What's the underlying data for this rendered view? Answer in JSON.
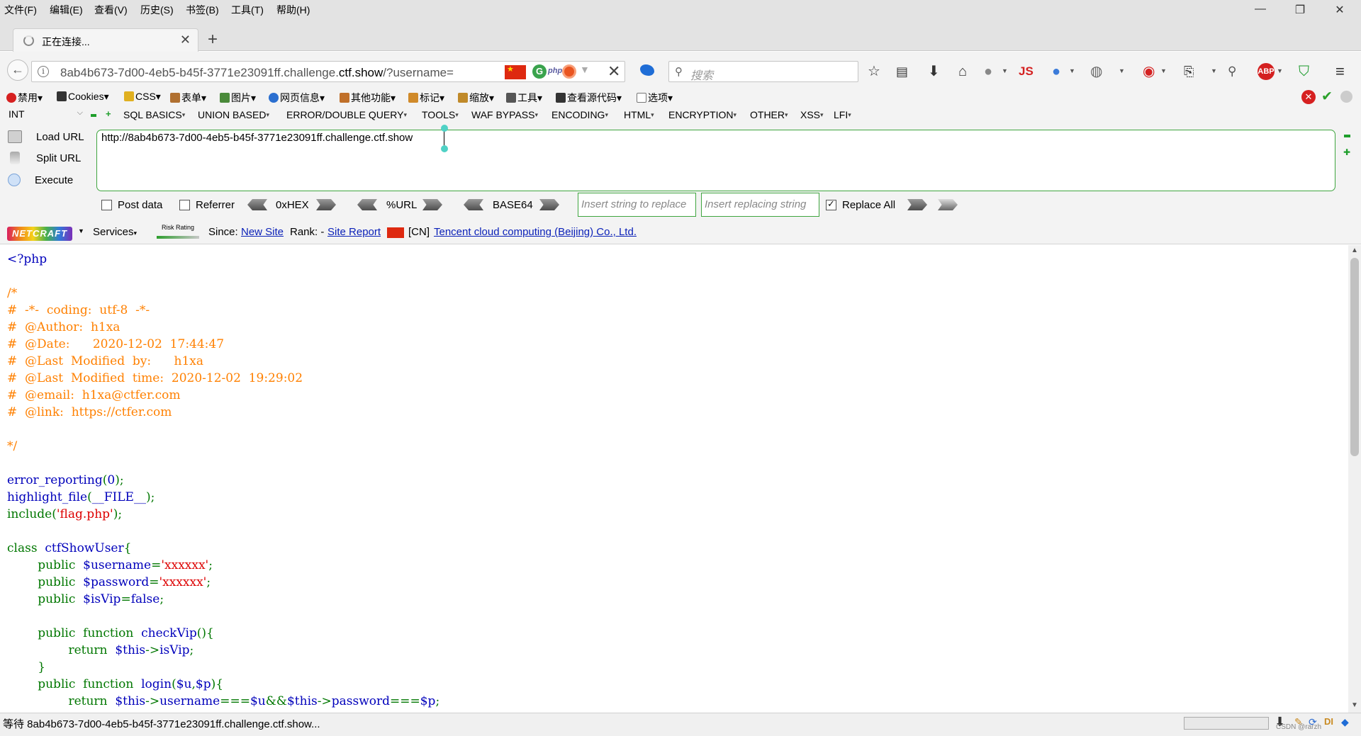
{
  "menu": [
    "文件(F)",
    "编辑(E)",
    "查看(V)",
    "历史(S)",
    "书签(B)",
    "工具(T)",
    "帮助(H)"
  ],
  "window": {
    "minimize": "—",
    "restore": "❐",
    "close": "✕"
  },
  "tab": {
    "title": "正在连接...",
    "close": "✕",
    "new_tab": "+"
  },
  "nav": {
    "back": "←",
    "url_prefix": "8ab4b673-7d00-4eb5-b45f-3771e23091ff.challenge.",
    "url_host": "ctf.show",
    "url_suffix": "/?username=",
    "php_label": "php",
    "stop": "✕",
    "search_placeholder": "搜索",
    "js_label": "JS",
    "abp_label": "ABP"
  },
  "cnbar": [
    {
      "label": "禁用",
      "color": "#d62020"
    },
    {
      "label": "Cookies",
      "color": "#333333"
    },
    {
      "label": "CSS",
      "color": "#e0b020"
    },
    {
      "label": "表单",
      "color": "#b07030"
    },
    {
      "label": "图片",
      "color": "#4a8a3a"
    },
    {
      "label": "网页信息",
      "color": "#2b6fd0"
    },
    {
      "label": "其他功能",
      "color": "#c0702a"
    },
    {
      "label": "标记",
      "color": "#d08a2a"
    },
    {
      "label": "缩放",
      "color": "#c08a2a"
    },
    {
      "label": "工具",
      "color": "#555555"
    },
    {
      "label": "查看源代码",
      "color": "#333333"
    },
    {
      "label": "选项",
      "color": "#777777"
    }
  ],
  "hackbar": {
    "select": "INT",
    "menus": [
      "SQL BASICS",
      "UNION BASED",
      "ERROR/DOUBLE QUERY",
      "TOOLS",
      "WAF BYPASS",
      "ENCODING",
      "HTML",
      "ENCRYPTION",
      "OTHER",
      "XSS",
      "LFI"
    ],
    "load_url": "Load URL",
    "split_url": "Split URL",
    "execute": "Execute",
    "url_value": "http://8ab4b673-7d00-4eb5-b45f-3771e23091ff.challenge.ctf.show",
    "post_data": "Post data",
    "referrer": "Referrer",
    "hex": "0xHEX",
    "urlenc": "%URL",
    "base64": "BASE64",
    "insert_placeholder": "Insert string to replace",
    "replacing_placeholder": "Insert replacing string",
    "replace_all": "Replace All",
    "post_checked": false,
    "referrer_checked": false,
    "replace_all_checked": true
  },
  "netcraft": {
    "logo": "NETCRAFT",
    "services": "Services",
    "risk": "Risk Rating",
    "since_label": "Since:",
    "since_link": "New Site",
    "rank_label": "Rank: -",
    "site_report": "Site Report",
    "country": "[CN]",
    "host_link": "Tencent cloud computing (Beijing) Co., Ltd."
  },
  "source_lines": [
    [
      {
        "c": "tag",
        "t": "<?php"
      }
    ],
    [],
    [
      {
        "c": "com",
        "t": "/*"
      }
    ],
    [
      {
        "c": "com",
        "t": "#  -*-  coding:  utf-8  -*-"
      }
    ],
    [
      {
        "c": "com",
        "t": "#  @Author:  h1xa"
      }
    ],
    [
      {
        "c": "com",
        "t": "#  @Date:      2020-12-02  17:44:47"
      }
    ],
    [
      {
        "c": "com",
        "t": "#  @Last  Modified  by:      h1xa"
      }
    ],
    [
      {
        "c": "com",
        "t": "#  @Last  Modified  time:  2020-12-02  19:29:02"
      }
    ],
    [
      {
        "c": "com",
        "t": "#  @email:  h1xa@ctfer.com"
      }
    ],
    [
      {
        "c": "com",
        "t": "#  @link:  https://ctfer.com"
      }
    ],
    [],
    [
      {
        "c": "com",
        "t": "*/"
      }
    ],
    [],
    [
      {
        "c": "def",
        "t": "error_reporting"
      },
      {
        "c": "kw",
        "t": "("
      },
      {
        "c": "def",
        "t": "0"
      },
      {
        "c": "kw",
        "t": ");"
      }
    ],
    [
      {
        "c": "def",
        "t": "highlight_file"
      },
      {
        "c": "kw",
        "t": "("
      },
      {
        "c": "def",
        "t": "__FILE__"
      },
      {
        "c": "kw",
        "t": ");"
      }
    ],
    [
      {
        "c": "kw",
        "t": "include("
      },
      {
        "c": "str",
        "t": "'flag.php'"
      },
      {
        "c": "kw",
        "t": ");"
      }
    ],
    [],
    [
      {
        "c": "kw",
        "t": "class  "
      },
      {
        "c": "def",
        "t": "ctfShowUser"
      },
      {
        "c": "kw",
        "t": "{"
      }
    ],
    [
      {
        "c": "kw",
        "t": "        public  "
      },
      {
        "c": "def",
        "t": "$username"
      },
      {
        "c": "kw",
        "t": "="
      },
      {
        "c": "str",
        "t": "'xxxxxx'"
      },
      {
        "c": "kw",
        "t": ";"
      }
    ],
    [
      {
        "c": "kw",
        "t": "        public  "
      },
      {
        "c": "def",
        "t": "$password"
      },
      {
        "c": "kw",
        "t": "="
      },
      {
        "c": "str",
        "t": "'xxxxxx'"
      },
      {
        "c": "kw",
        "t": ";"
      }
    ],
    [
      {
        "c": "kw",
        "t": "        public  "
      },
      {
        "c": "def",
        "t": "$isVip"
      },
      {
        "c": "kw",
        "t": "="
      },
      {
        "c": "def",
        "t": "false"
      },
      {
        "c": "kw",
        "t": ";"
      }
    ],
    [],
    [
      {
        "c": "kw",
        "t": "        public  function  "
      },
      {
        "c": "def",
        "t": "checkVip"
      },
      {
        "c": "kw",
        "t": "(){"
      }
    ],
    [
      {
        "c": "kw",
        "t": "                return  "
      },
      {
        "c": "def",
        "t": "$this"
      },
      {
        "c": "kw",
        "t": "->"
      },
      {
        "c": "def",
        "t": "isVip"
      },
      {
        "c": "kw",
        "t": ";"
      }
    ],
    [
      {
        "c": "kw",
        "t": "        }"
      }
    ],
    [
      {
        "c": "kw",
        "t": "        public  function  "
      },
      {
        "c": "def",
        "t": "login"
      },
      {
        "c": "kw",
        "t": "("
      },
      {
        "c": "def",
        "t": "$u"
      },
      {
        "c": "kw",
        "t": ","
      },
      {
        "c": "def",
        "t": "$p"
      },
      {
        "c": "kw",
        "t": "){"
      }
    ],
    [
      {
        "c": "kw",
        "t": "                return  "
      },
      {
        "c": "def",
        "t": "$this"
      },
      {
        "c": "kw",
        "t": "->"
      },
      {
        "c": "def",
        "t": "username"
      },
      {
        "c": "kw",
        "t": "==="
      },
      {
        "c": "def",
        "t": "$u"
      },
      {
        "c": "kw",
        "t": "&&"
      },
      {
        "c": "def",
        "t": "$this"
      },
      {
        "c": "kw",
        "t": "->"
      },
      {
        "c": "def",
        "t": "password"
      },
      {
        "c": "kw",
        "t": "==="
      },
      {
        "c": "def",
        "t": "$p"
      },
      {
        "c": "kw",
        "t": ";"
      }
    ]
  ],
  "status": {
    "text": "等待 8ab4b673-7d00-4eb5-b45f-3771e23091ff.challenge.ctf.show...",
    "watermark": "CSDN @rarzh"
  }
}
